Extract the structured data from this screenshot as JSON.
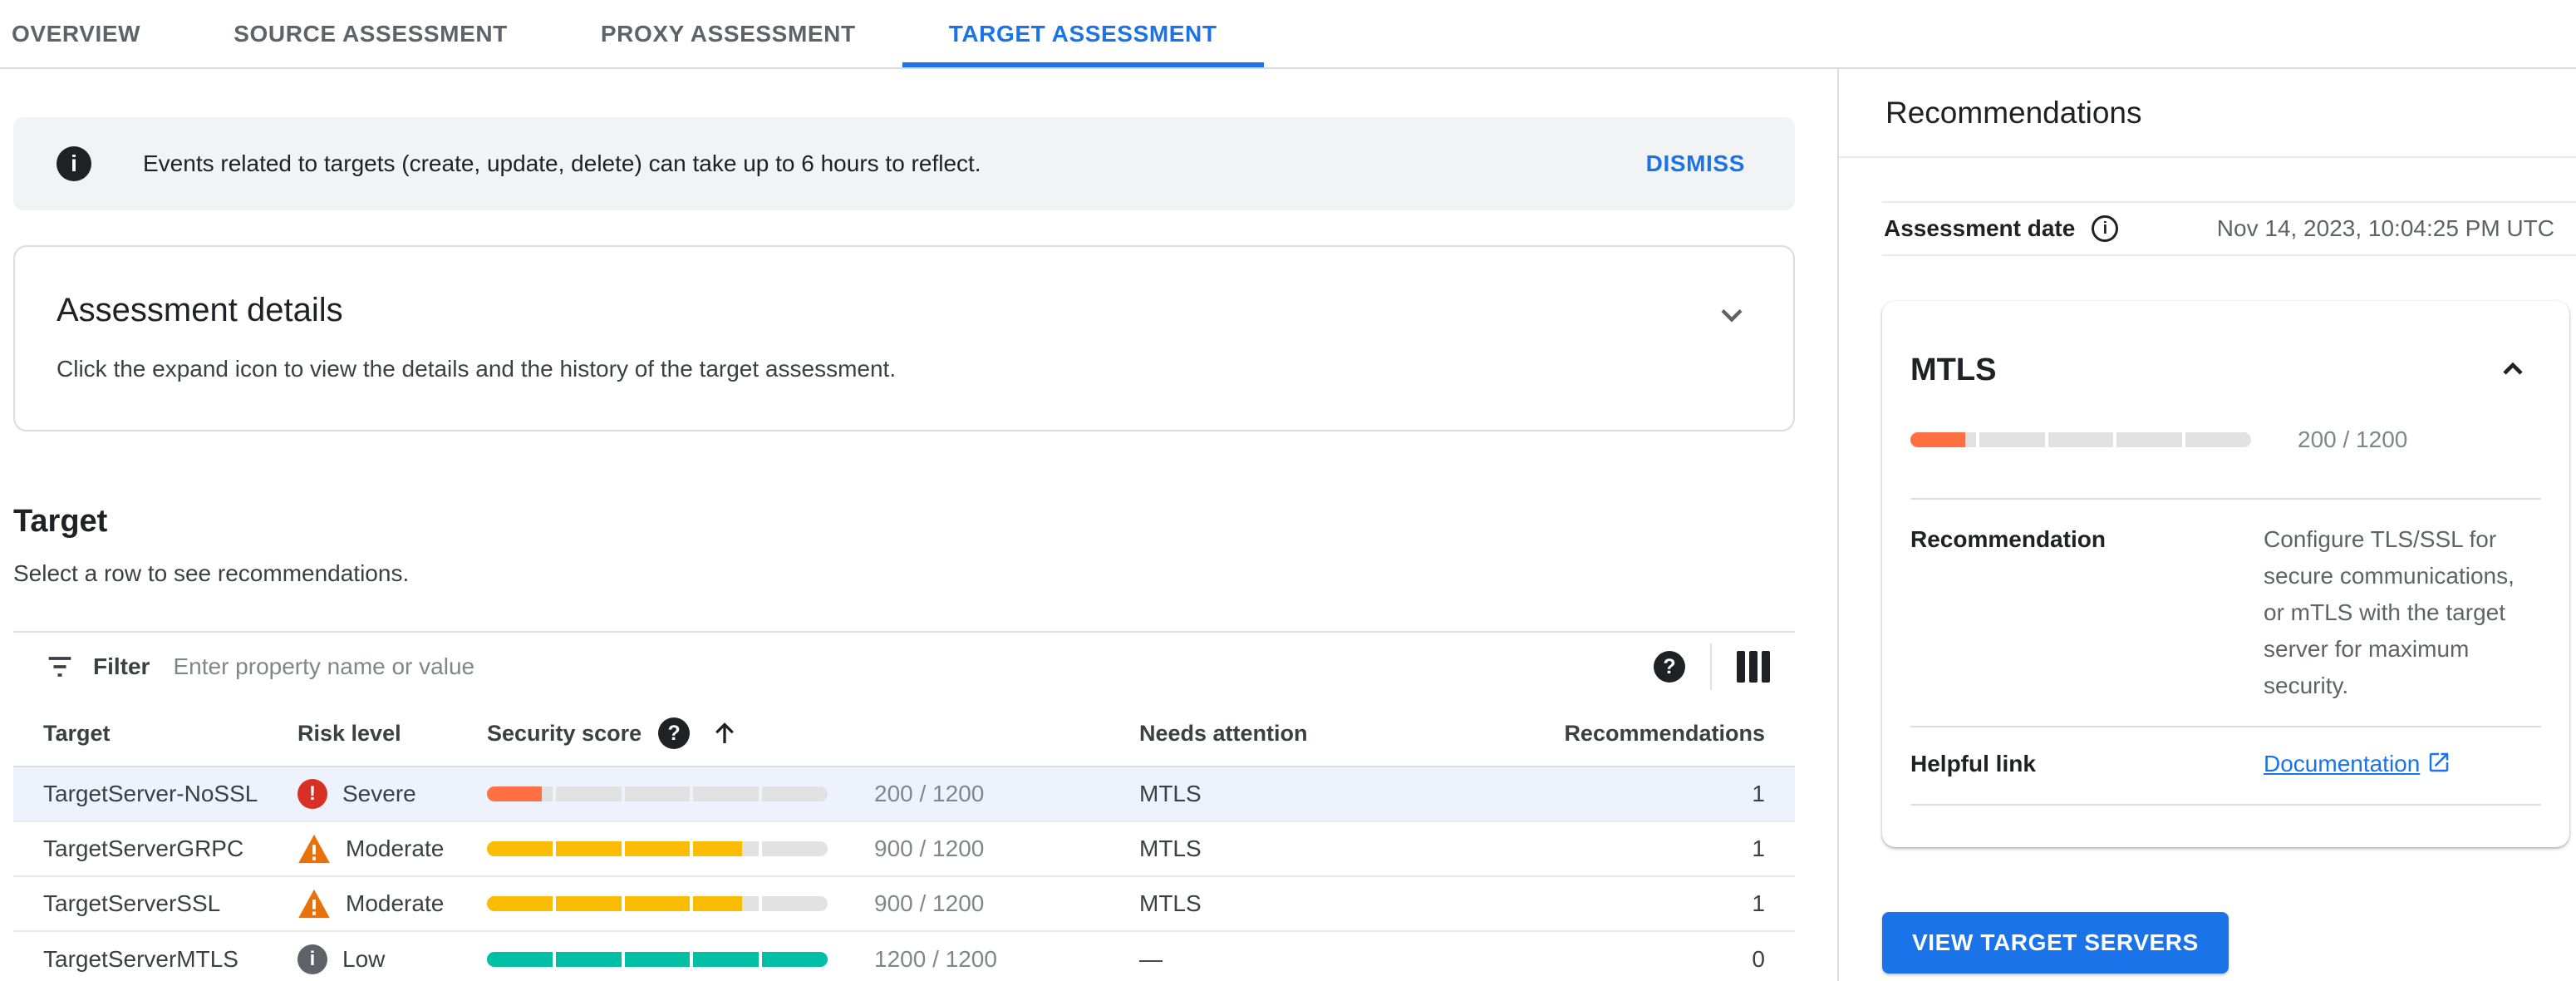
{
  "colors": {
    "accent": "#1A73E8",
    "severe": "#D93025",
    "moderate": "#E8710A",
    "low": "#5F6368"
  },
  "tabs": [
    {
      "label": "OVERVIEW"
    },
    {
      "label": "SOURCE ASSESSMENT"
    },
    {
      "label": "PROXY ASSESSMENT"
    },
    {
      "label": "TARGET ASSESSMENT"
    }
  ],
  "banner": {
    "message": "Events related to targets (create, update, delete) can take up to 6 hours to reflect.",
    "dismiss_label": "DISMISS"
  },
  "assessment_details": {
    "title": "Assessment details",
    "subtitle": "Click the expand icon to view the details and the history of the target assessment."
  },
  "target_section": {
    "title": "Target",
    "subtitle": "Select a row to see recommendations.",
    "filter": {
      "label": "Filter",
      "placeholder": "Enter property name or value"
    },
    "table": {
      "columns": {
        "target": "Target",
        "risk": "Risk level",
        "score": "Security score",
        "needs": "Needs attention",
        "recs": "Recommendations"
      },
      "rows": [
        {
          "target": "TargetServer-NoSSL",
          "risk": "Severe",
          "score": 200,
          "score_max": 1200,
          "score_text": "200 / 1200",
          "needs": "MTLS",
          "recs": "1",
          "bar_color": "#FF7043"
        },
        {
          "target": "TargetServerGRPC",
          "risk": "Moderate",
          "score": 900,
          "score_max": 1200,
          "score_text": "900 / 1200",
          "needs": "MTLS",
          "recs": "1",
          "bar_color": "#FBBC04"
        },
        {
          "target": "TargetServerSSL",
          "risk": "Moderate",
          "score": 900,
          "score_max": 1200,
          "score_text": "900 / 1200",
          "needs": "MTLS",
          "recs": "1",
          "bar_color": "#FBBC04"
        },
        {
          "target": "TargetServerMTLS",
          "risk": "Low",
          "score": 1200,
          "score_max": 1200,
          "score_text": "1200 / 1200",
          "needs": "—",
          "recs": "0",
          "bar_color": "#00BFA5"
        }
      ]
    }
  },
  "recommendations_panel": {
    "title": "Recommendations",
    "assessment_date_label": "Assessment date",
    "assessment_date": "Nov 14, 2023, 10:04:25 PM UTC",
    "card": {
      "title": "MTLS",
      "score": 200,
      "score_max": 1200,
      "score_text": "200 / 1200",
      "bar_color": "#FF7043",
      "recommendation_label": "Recommendation",
      "recommendation": "Configure TLS/SSL for secure communications, or mTLS with the target server for maximum security.",
      "helpful_link_label": "Helpful link",
      "helpful_link": "Documentation"
    },
    "view_button": "VIEW TARGET SERVERS"
  }
}
